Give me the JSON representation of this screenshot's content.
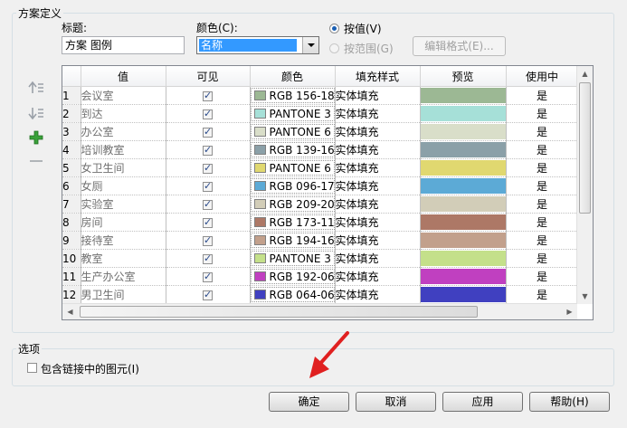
{
  "scheme_group": {
    "title": "方案定义"
  },
  "title_field": {
    "label": "标题:",
    "value": "方案 图例"
  },
  "color_field": {
    "label": "颜色(C):",
    "selected": "名称"
  },
  "radio_by_value": {
    "label": "按值(V)",
    "checked": true
  },
  "radio_by_range": {
    "label": "按范围(G)",
    "checked": false
  },
  "edit_format_button": {
    "label": "编辑格式(E)..."
  },
  "side_tools": {
    "move_up": "move-row-up-icon",
    "move_down": "move-row-down-icon",
    "add": "add-row-icon",
    "remove": "remove-row-icon"
  },
  "table": {
    "headers": [
      "",
      "值",
      "可见",
      "颜色",
      "填充样式",
      "预览",
      "使用中"
    ],
    "rows": [
      {
        "num": "1",
        "value": "会议室",
        "visible": true,
        "color_text": "RGB 156-18",
        "swatch": "#9cb894",
        "fill": "实体填充",
        "in_use": "是"
      },
      {
        "num": "2",
        "value": "到达",
        "visible": true,
        "color_text": "PANTONE 3",
        "swatch": "#a6e0d8",
        "fill": "实体填充",
        "in_use": "是"
      },
      {
        "num": "3",
        "value": "办公室",
        "visible": true,
        "color_text": "PANTONE 6",
        "swatch": "#d9dec9",
        "fill": "实体填充",
        "in_use": "是"
      },
      {
        "num": "4",
        "value": "培训教室",
        "visible": true,
        "color_text": "RGB 139-16",
        "swatch": "#8ba0a8",
        "fill": "实体填充",
        "in_use": "是"
      },
      {
        "num": "5",
        "value": "女卫生间",
        "visible": true,
        "color_text": "PANTONE 6",
        "swatch": "#e0d870",
        "fill": "实体填充",
        "in_use": "是"
      },
      {
        "num": "6",
        "value": "女厕",
        "visible": true,
        "color_text": "RGB 096-17",
        "swatch": "#5caad6",
        "fill": "实体填充",
        "in_use": "是"
      },
      {
        "num": "7",
        "value": "实验室",
        "visible": true,
        "color_text": "RGB 209-20",
        "swatch": "#d2cdb8",
        "fill": "实体填充",
        "in_use": "是"
      },
      {
        "num": "8",
        "value": "房间",
        "visible": true,
        "color_text": "RGB 173-11",
        "swatch": "#ad7866",
        "fill": "实体填充",
        "in_use": "是"
      },
      {
        "num": "9",
        "value": "接待室",
        "visible": true,
        "color_text": "RGB 194-16",
        "swatch": "#c2a08c",
        "fill": "实体填充",
        "in_use": "是"
      },
      {
        "num": "10",
        "value": "教室",
        "visible": true,
        "color_text": "PANTONE 3",
        "swatch": "#c4e08a",
        "fill": "实体填充",
        "in_use": "是"
      },
      {
        "num": "11",
        "value": "生产办公室",
        "visible": true,
        "color_text": "RGB 192-06",
        "swatch": "#c040c0",
        "fill": "实体填充",
        "in_use": "是"
      },
      {
        "num": "12",
        "value": "男卫生间",
        "visible": true,
        "color_text": "RGB 064-06",
        "swatch": "#4040c0",
        "fill": "实体填充",
        "in_use": "是"
      }
    ]
  },
  "options_group": {
    "title": "选项"
  },
  "include_linked": {
    "label": "包含链接中的图元(I)",
    "checked": false
  },
  "buttons": {
    "ok": "确定",
    "cancel": "取消",
    "apply": "应用",
    "help": "帮助(H)"
  },
  "annotation": {
    "color": "#e02020"
  }
}
